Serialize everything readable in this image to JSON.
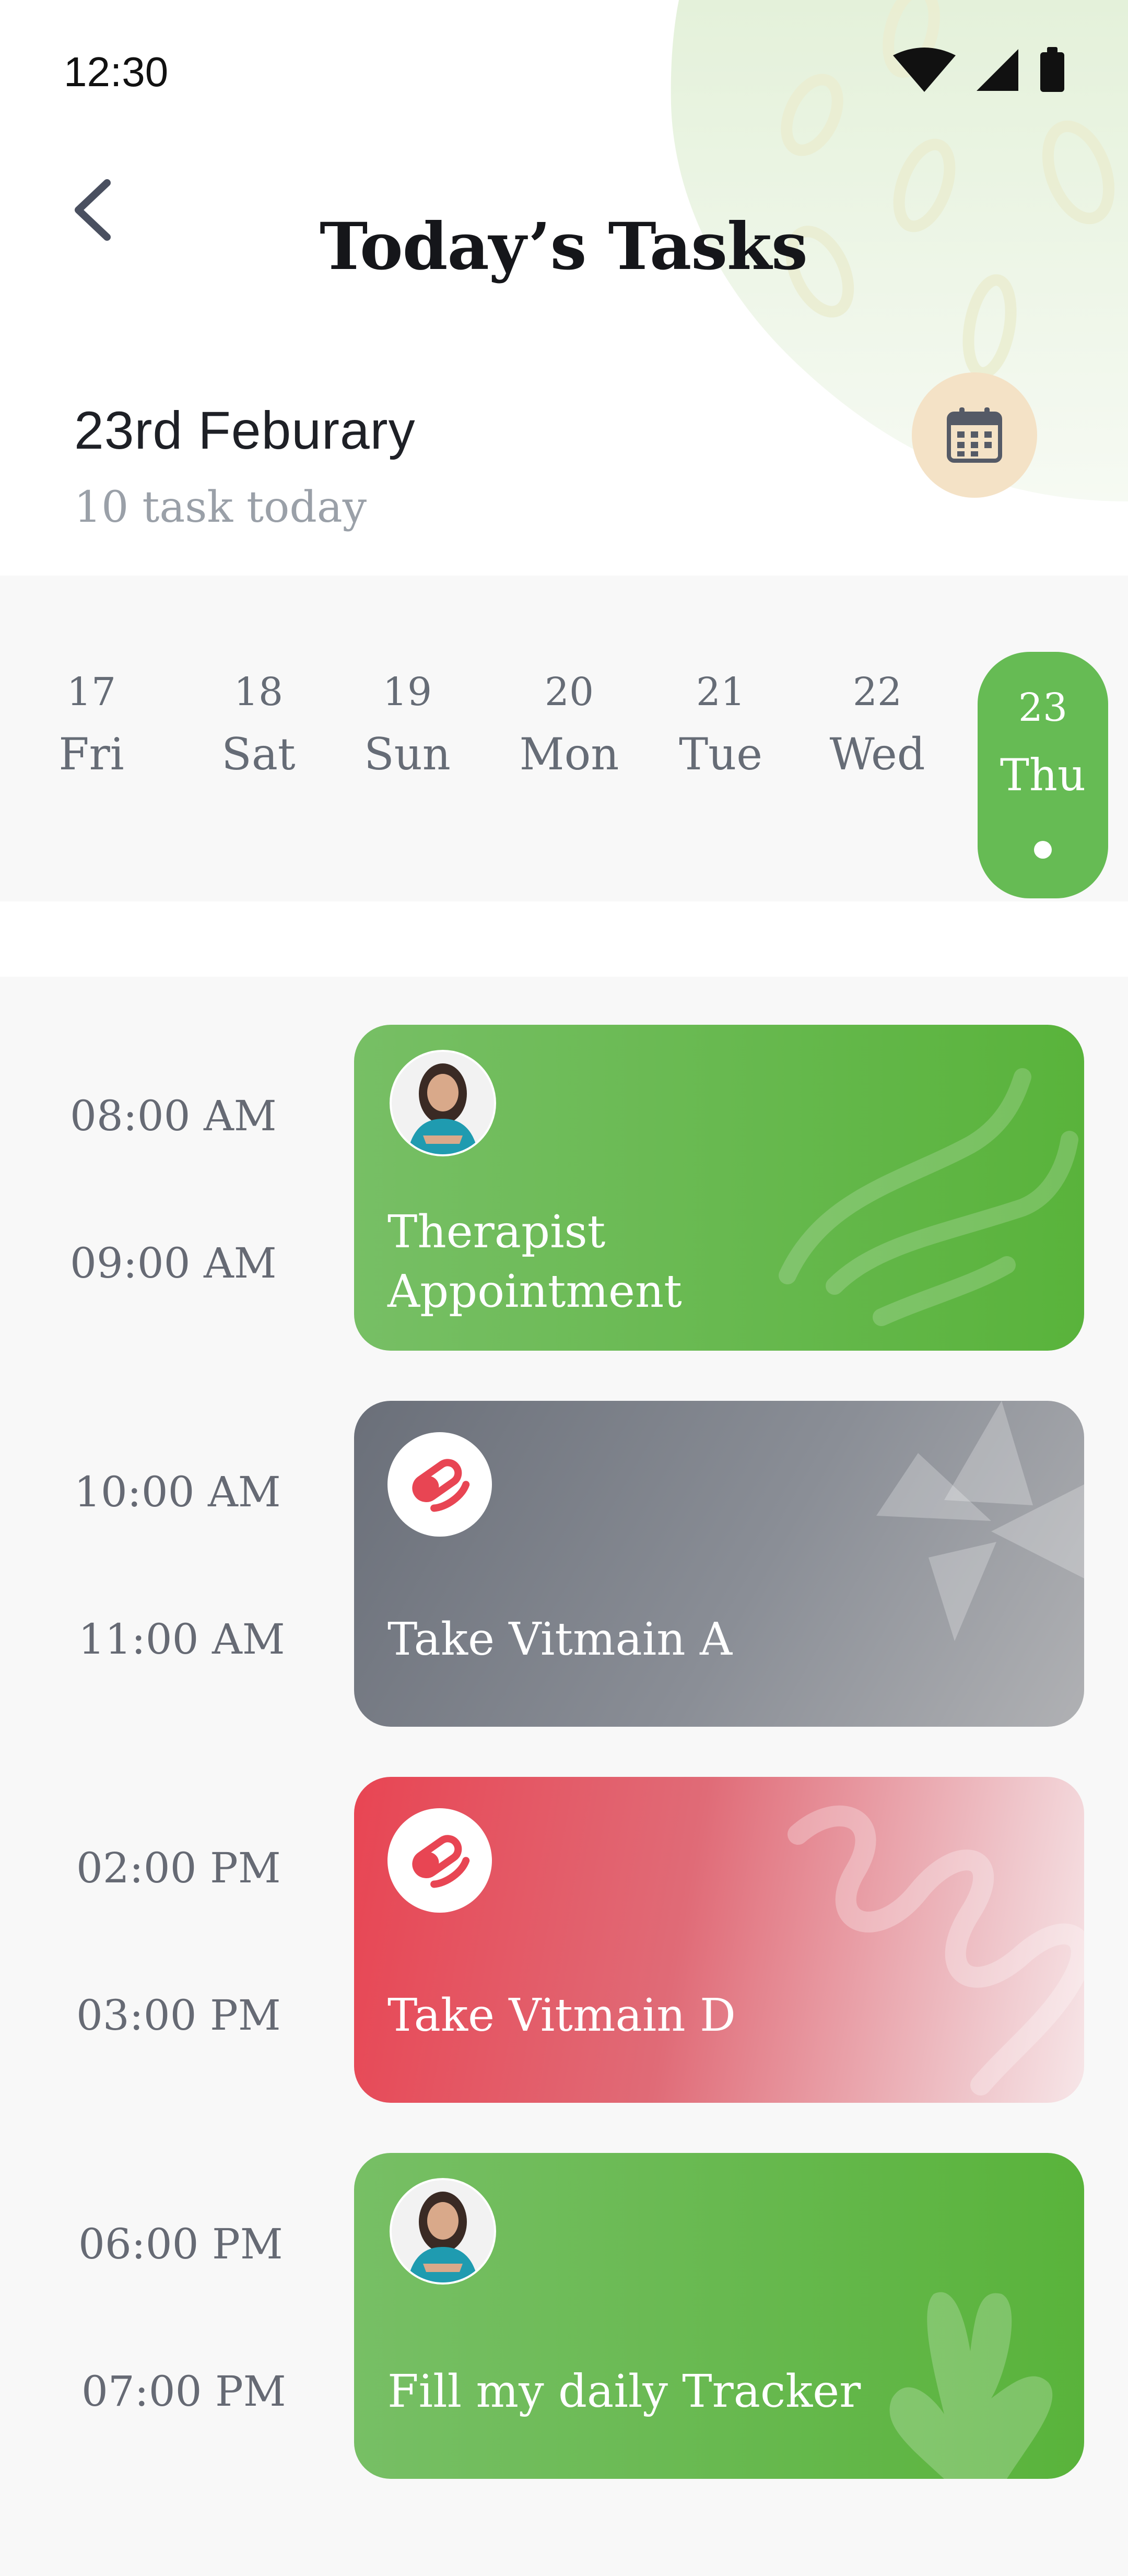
{
  "status_bar": {
    "time": "12:30"
  },
  "header": {
    "title": "Today’s Tasks"
  },
  "summary": {
    "date": "23rd Feburary",
    "task_count": "10 task today"
  },
  "days": [
    {
      "num": "17",
      "name": "Fri"
    },
    {
      "num": "18",
      "name": "Sat"
    },
    {
      "num": "19",
      "name": "Sun"
    },
    {
      "num": "20",
      "name": "Mon"
    },
    {
      "num": "21",
      "name": "Tue"
    },
    {
      "num": "22",
      "name": "Wed"
    },
    {
      "num": "23",
      "name": "Thu",
      "selected": true
    }
  ],
  "tasks": [
    {
      "start": "08:00 AM",
      "end": "09:00 AM",
      "line1": "Therapist",
      "line2": "Appointment",
      "icon": "therapist-avatar",
      "color": "#59b33b"
    },
    {
      "start": "10:00 AM",
      "end": "11:00 AM",
      "line1": "Take Vitmain A",
      "icon": "pill-icon",
      "color": "#6a6f79"
    },
    {
      "start": "02:00 PM",
      "end": "03:00 PM",
      "line1": "Take Vitmain D",
      "icon": "pill-icon",
      "color": "#e84553"
    },
    {
      "start": "06:00 PM",
      "end": "07:00 PM",
      "line1": "Fill my daily Tracker",
      "icon": "therapist-avatar",
      "color": "#59b33b"
    }
  ],
  "colors": {
    "accent_green": "#66bb54",
    "pill_red": "#e84553",
    "calendar_bg": "#f4e2c6"
  }
}
